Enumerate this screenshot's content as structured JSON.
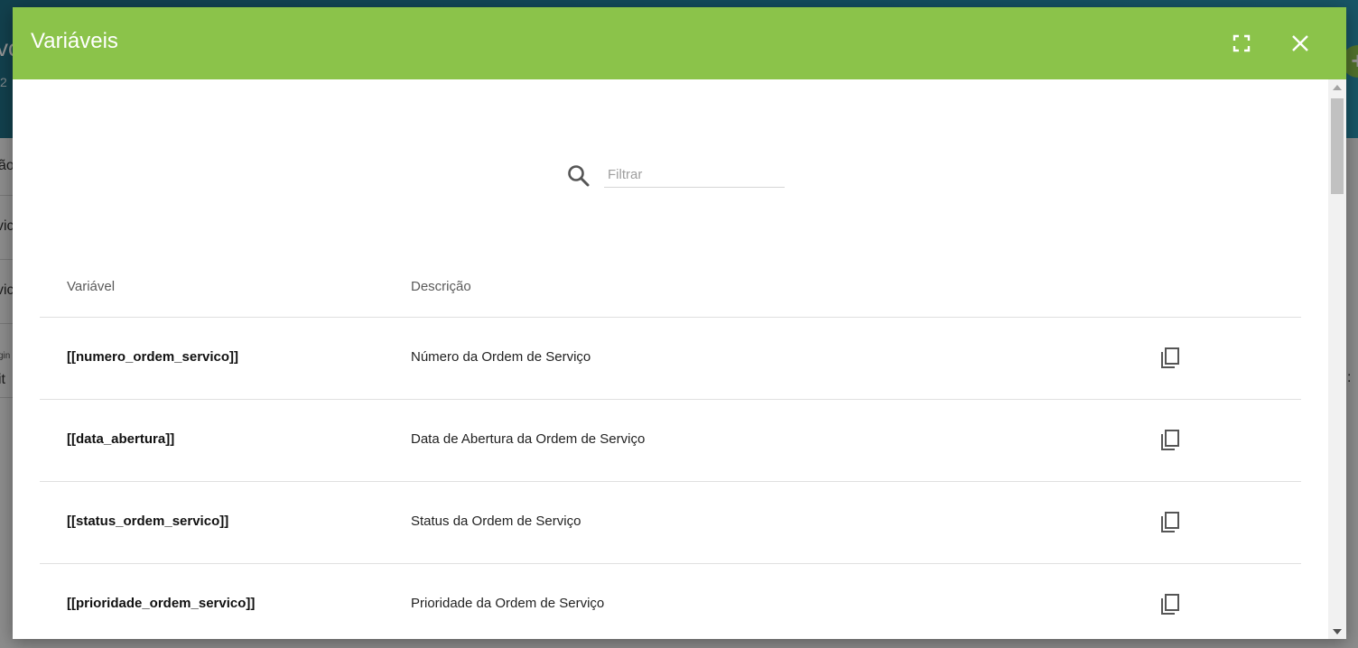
{
  "dialog": {
    "title": "Variáveis",
    "fullscreen_icon": "fullscreen-icon",
    "close_icon": "close-icon",
    "accent_color": "#8bc34a"
  },
  "search": {
    "placeholder": "Filtrar",
    "value": "",
    "icon": "search-icon"
  },
  "table": {
    "headers": {
      "variable": "Variável",
      "description": "Descrição"
    },
    "rows": [
      {
        "variable": "[[numero_ordem_servico]]",
        "description": "Número da Ordem de Serviço"
      },
      {
        "variable": "[[data_abertura]]",
        "description": "Data de Abertura da Ordem de Serviço"
      },
      {
        "variable": "[[status_ordem_servico]]",
        "description": "Status da Ordem de Serviço"
      },
      {
        "variable": "[[prioridade_ordem_servico]]",
        "description": "Prioridade da Ordem de Serviço"
      }
    ],
    "row_action_icon": "copy-icon"
  },
  "background": {
    "title_fragment": "vo",
    "subtitle_fragment": "2",
    "items": [
      "ão",
      "vic",
      "vic",
      "it"
    ],
    "tiny_label": "gin",
    "right_fragment": ":",
    "fab_label": "+"
  }
}
